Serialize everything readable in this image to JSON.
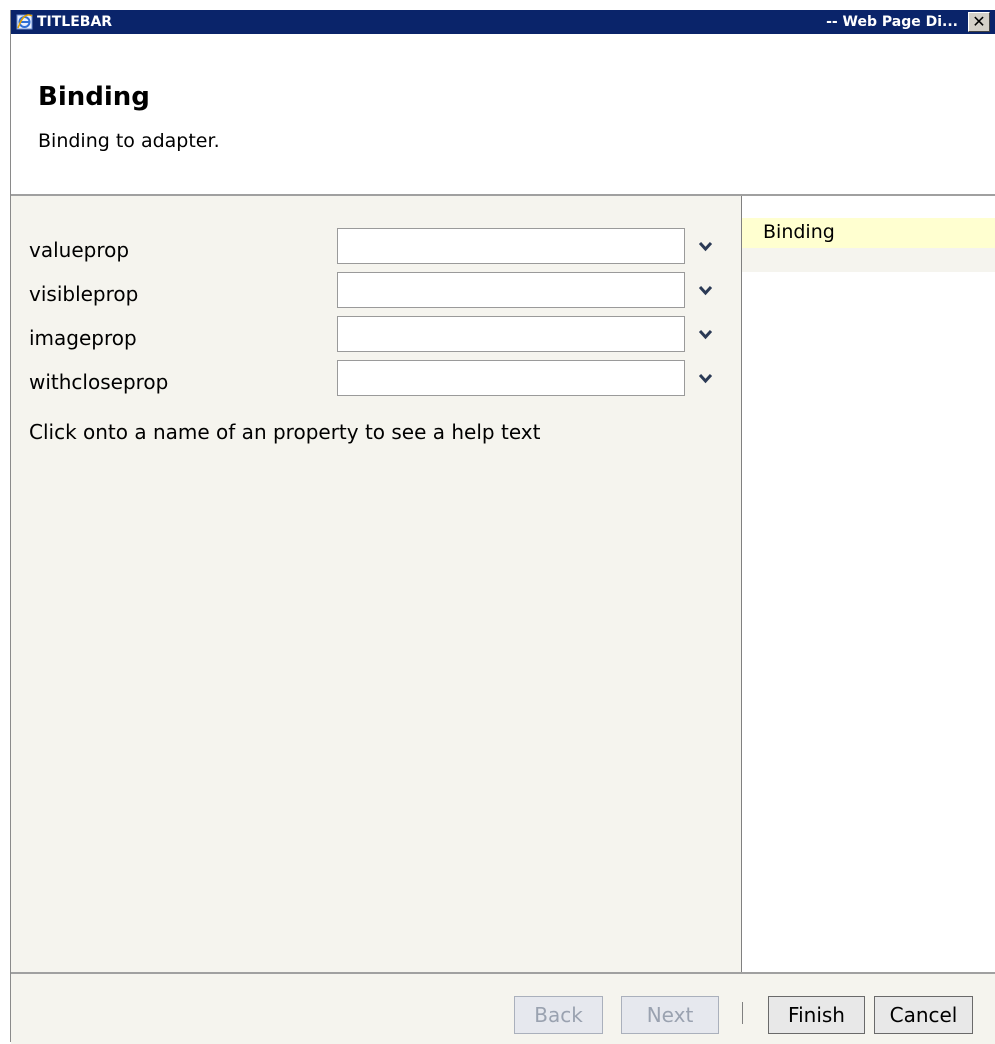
{
  "titlebar": {
    "left_title": "TITLEBAR",
    "right_title": "-- Web Page Di...",
    "close_glyph": "✕",
    "app_icon": "ie-icon"
  },
  "header": {
    "title": "Binding",
    "subtitle": "Binding to adapter."
  },
  "properties": [
    {
      "label": "valueprop",
      "value": ""
    },
    {
      "label": "visibleprop",
      "value": ""
    },
    {
      "label": "imageprop",
      "value": ""
    },
    {
      "label": "withcloseprop",
      "value": ""
    }
  ],
  "help_hint": "Click onto a name of an property to see a help text",
  "side_panel": {
    "items": [
      {
        "label": "Binding",
        "selected": true
      }
    ]
  },
  "footer": {
    "back_label": "Back",
    "next_label": "Next",
    "finish_label": "Finish",
    "cancel_label": "Cancel"
  },
  "colors": {
    "titlebar": "#0a246a",
    "panel": "#f5f4ee",
    "highlight": "#ffffd0"
  }
}
